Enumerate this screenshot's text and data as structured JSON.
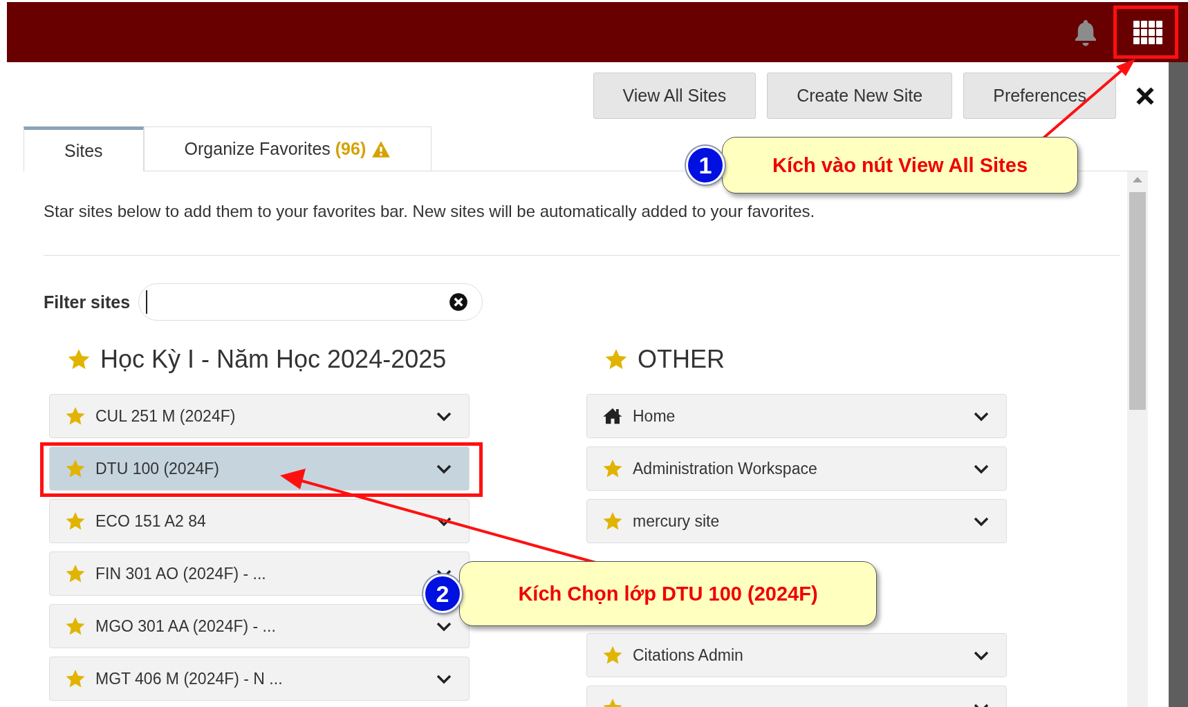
{
  "buttons": [
    "View All Sites",
    "Create New Site",
    "Preferences"
  ],
  "tabs": [
    {
      "label": "Sites",
      "selected": true
    },
    {
      "label": "Organize Favorites",
      "count": "(96)",
      "warning": true,
      "selected": false
    }
  ],
  "description": "Star sites below to add them to your favorites bar. New sites will be automatically added to your favorites.",
  "filter": {
    "label": "Filter sites"
  },
  "groups": [
    {
      "title": "Học Kỳ I - Năm Học 2024-2025",
      "favorite": true,
      "sites": [
        {
          "name": "CUL 251 M (2024F)",
          "kind": "star",
          "favorite": true,
          "selected": false
        },
        {
          "name": "DTU 100 (2024F)",
          "kind": "star",
          "favorite": true,
          "selected": true
        },
        {
          "name": "ECO 151 A2 84",
          "kind": "star",
          "favorite": true,
          "selected": false
        },
        {
          "name": "FIN 301 AO (2024F) - ...",
          "kind": "star",
          "favorite": true,
          "selected": false
        },
        {
          "name": "MGO 301 AA (2024F) - ...",
          "kind": "star",
          "favorite": true,
          "selected": false
        },
        {
          "name": "MGT 406 M (2024F) - N ...",
          "kind": "star",
          "favorite": true,
          "selected": false
        }
      ]
    },
    {
      "title": "OTHER",
      "favorite": true,
      "sites": [
        {
          "name": "Home",
          "kind": "home",
          "selected": false
        },
        {
          "name": "Administration Workspace",
          "kind": "star",
          "favorite": true,
          "selected": false
        },
        {
          "name": "mercury site",
          "kind": "star",
          "favorite": true,
          "selected": false
        },
        {
          "name": "Citations Admin",
          "kind": "star",
          "favorite": true,
          "selected": false
        },
        {
          "kind": "star",
          "favorite": true,
          "selected": false
        }
      ]
    }
  ],
  "annotations": [
    {
      "number": "1",
      "text": "Kích vào nút View All Sites"
    },
    {
      "number": "2",
      "text": "Kích Chọn lớp DTU 100 (2024F)"
    }
  ]
}
